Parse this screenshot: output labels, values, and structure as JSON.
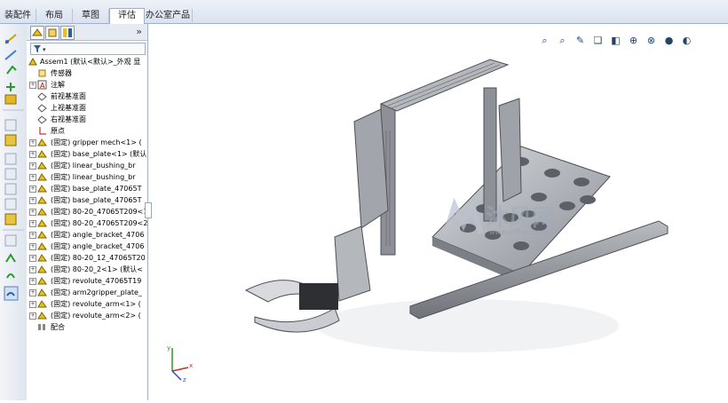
{
  "top_tabs": [
    {
      "label": "装配件"
    },
    {
      "label": "布局"
    },
    {
      "label": "草图"
    },
    {
      "label": "评估"
    },
    {
      "label": "办公室产品"
    }
  ],
  "filter": {
    "placeholder": ""
  },
  "tree": {
    "root": "Assem1  (默认<默认>_外观 显",
    "items": [
      {
        "label": "传感器",
        "icon": "sensor-icon"
      },
      {
        "label": "注解",
        "icon": "annotation-icon"
      },
      {
        "label": "前视基准面",
        "icon": "plane-icon"
      },
      {
        "label": "上视基准面",
        "icon": "plane-icon"
      },
      {
        "label": "右视基准面",
        "icon": "plane-icon"
      },
      {
        "label": "原点",
        "icon": "origin-icon"
      },
      {
        "label": "(固定) gripper mech<1> (",
        "icon": "part-icon"
      },
      {
        "label": "(固定) base_plate<1> (默认",
        "icon": "part-icon"
      },
      {
        "label": "(固定) linear_bushing_br",
        "icon": "part-icon"
      },
      {
        "label": "(固定) linear_bushing_br",
        "icon": "part-icon"
      },
      {
        "label": "(固定) base_plate_47065T",
        "icon": "part-icon"
      },
      {
        "label": "(固定) base_plate_47065T",
        "icon": "part-icon"
      },
      {
        "label": "(固定) 80-20_47065T209<1",
        "icon": "part-icon"
      },
      {
        "label": "(固定) 80-20_47065T209<2",
        "icon": "part-icon"
      },
      {
        "label": "(固定) angle_bracket_4706",
        "icon": "part-icon"
      },
      {
        "label": "(固定) angle_bracket_4706",
        "icon": "part-icon"
      },
      {
        "label": "(固定) 80-20_12_47065T20",
        "icon": "part-icon"
      },
      {
        "label": "(固定) 80-20_2<1> (默认<",
        "icon": "part-icon"
      },
      {
        "label": "(固定) revolute_47065T19",
        "icon": "part-icon"
      },
      {
        "label": "(固定) arm2gripper_plate_",
        "icon": "part-icon"
      },
      {
        "label": "(固定) revolute_arm<1> (",
        "icon": "part-icon"
      },
      {
        "label": "(固定) revolute_arm<2> (",
        "icon": "part-icon"
      },
      {
        "label": "配合",
        "icon": "mate-icon"
      }
    ]
  },
  "watermark": {
    "main": "沐风网",
    "sub": "www.mfcad.com"
  },
  "axis": {
    "x": "x",
    "y": "y",
    "z": "z"
  },
  "colors": {
    "accent": "#2d5da8",
    "tab_bg": "#d9e2ef",
    "part_yellow": "#e6c21c",
    "model_gray": "#a9adb3"
  }
}
